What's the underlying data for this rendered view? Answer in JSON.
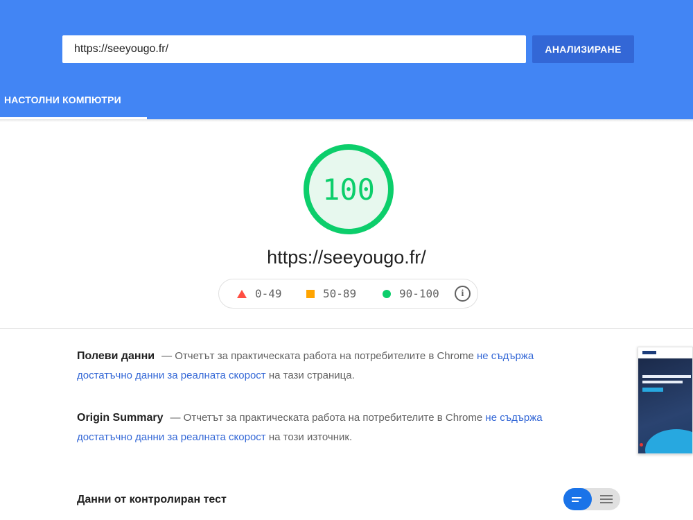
{
  "header": {
    "url_value": "https://seeyougo.fr/",
    "analyze_label": "АНАЛИЗИРАНЕ",
    "tabs": [
      {
        "label": "НАСТОЛНИ КОМПЮТРИ",
        "active": true
      }
    ]
  },
  "score": {
    "value": "100",
    "value_fraction": 1.0,
    "color": "#0cce6b",
    "tested_url": "https://seeyougo.fr/"
  },
  "legend": {
    "items": [
      {
        "icon": "triangle-icon",
        "label": "0-49",
        "color": "#ff4e42"
      },
      {
        "icon": "square-icon",
        "label": "50-89",
        "color": "#ffa400"
      },
      {
        "icon": "circle-icon",
        "label": "90-100",
        "color": "#0cce6b"
      }
    ],
    "info_icon": "info-icon"
  },
  "field_data": {
    "title": "Полеви данни",
    "text_before": "— Отчетът за практическата работа на потребителите в Chrome ",
    "link": "не съдържа достатъчно данни за реалната скорост",
    "text_after": " на тази страница."
  },
  "origin_summary": {
    "title": "Origin Summary",
    "text_before": "— Отчетът за практическата работа на потребителите в Chrome ",
    "link": "не съдържа достатъчно данни за реалната скорост",
    "text_after": " на този източник."
  },
  "lab_data": {
    "title": "Данни от контролиран тест",
    "view_toggle": {
      "options": [
        "compact-view-icon",
        "list-view-icon"
      ],
      "selected": "compact-view-icon"
    }
  },
  "colors": {
    "header_bg": "#4285f4",
    "button_bg": "#3367d6",
    "link": "#3367d6",
    "pass": "#0cce6b",
    "average": "#ffa400",
    "fail": "#ff4e42"
  }
}
